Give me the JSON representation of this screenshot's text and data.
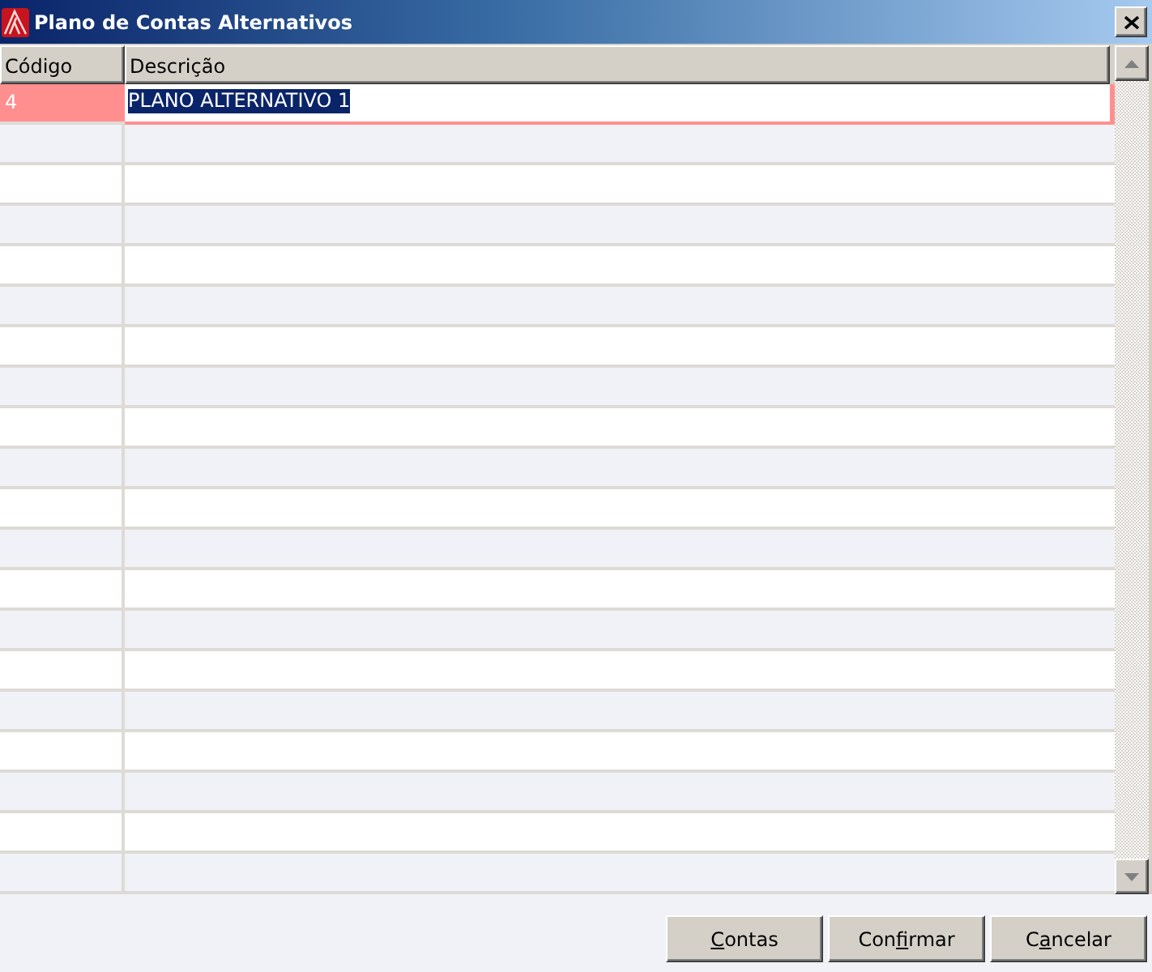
{
  "window": {
    "title": "Plano de Contas Alternativos"
  },
  "table": {
    "columns": [
      "Código",
      "Descrição"
    ],
    "rows": [
      {
        "code": "4",
        "description": "PLANO ALTERNATIVO 1",
        "selected": true
      }
    ]
  },
  "buttons": [
    {
      "underlined": "C",
      "after": "ontas"
    },
    {
      "before": "Con",
      "underlined": "f",
      "after": "irmar"
    },
    {
      "before": "C",
      "underlined": "a",
      "after": "ncelar"
    }
  ]
}
